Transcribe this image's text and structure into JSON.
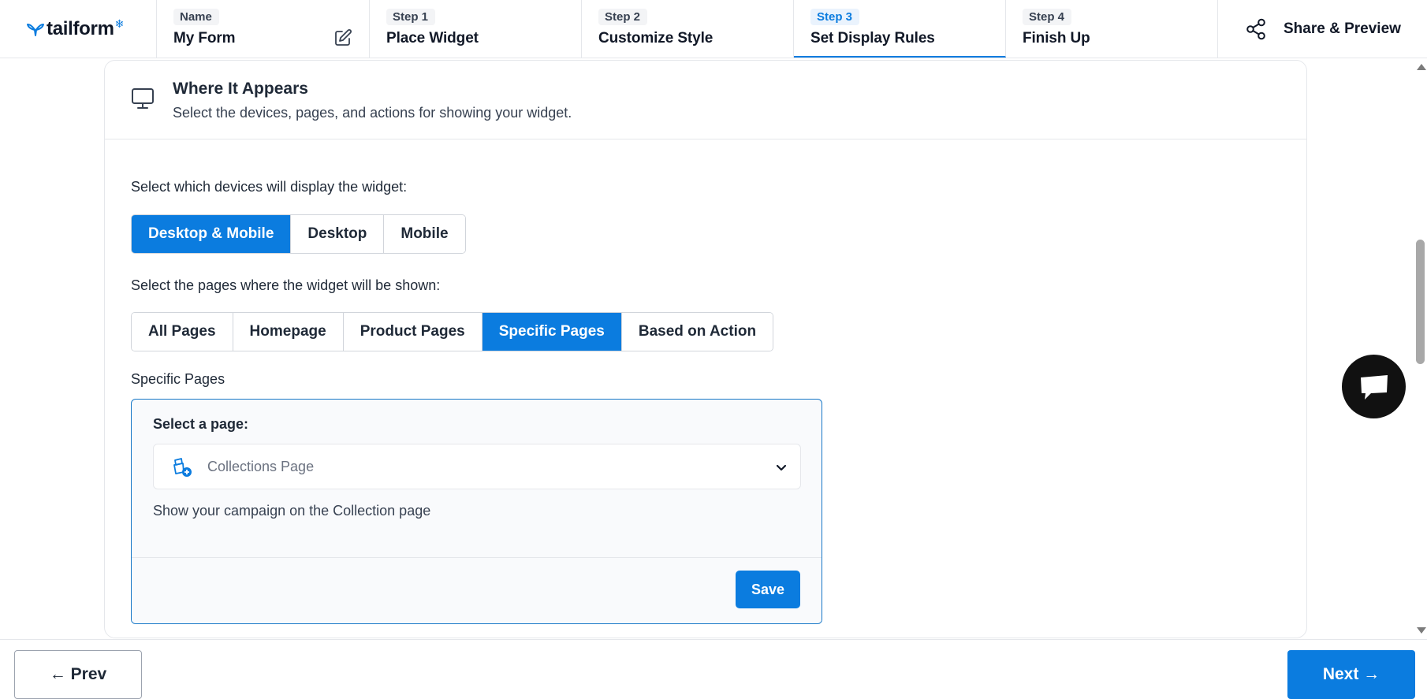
{
  "brand": {
    "name": "tailform",
    "accent_color": "#0b7cdf",
    "logo_icon": "whale-tail-icon",
    "star_icon": "snowflake-icon"
  },
  "steps": [
    {
      "tag": "Name",
      "title": "My Form",
      "icon": "edit-icon",
      "active": false
    },
    {
      "tag": "Step 1",
      "title": "Place Widget",
      "active": false
    },
    {
      "tag": "Step 2",
      "title": "Customize Style",
      "active": false
    },
    {
      "tag": "Step 3",
      "title": "Set Display Rules",
      "active": true
    },
    {
      "tag": "Step 4",
      "title": "Finish Up",
      "active": false
    }
  ],
  "share": {
    "label": "Share & Preview",
    "icon": "share-icon"
  },
  "section": {
    "icon": "monitor-icon",
    "title": "Where It Appears",
    "subtitle": "Select the devices, pages, and actions for showing your widget."
  },
  "devices": {
    "label": "Select which devices will display the widget:",
    "options": [
      "Desktop & Mobile",
      "Desktop",
      "Mobile"
    ],
    "selected": "Desktop & Mobile"
  },
  "pages": {
    "label": "Select the pages where the widget will be shown:",
    "options": [
      "All Pages",
      "Homepage",
      "Product Pages",
      "Specific Pages",
      "Based on Action"
    ],
    "selected": "Specific Pages"
  },
  "specific_pages": {
    "heading": "Specific Pages",
    "select_label": "Select a page:",
    "selected_page": "Collections Page",
    "page_icon": "collection-add-icon",
    "description": "Show your campaign on the Collection page",
    "save_label": "Save"
  },
  "footer": {
    "prev_label": "← Prev",
    "next_label": "Next →"
  },
  "chat": {
    "icon": "chat-bubble-icon"
  }
}
